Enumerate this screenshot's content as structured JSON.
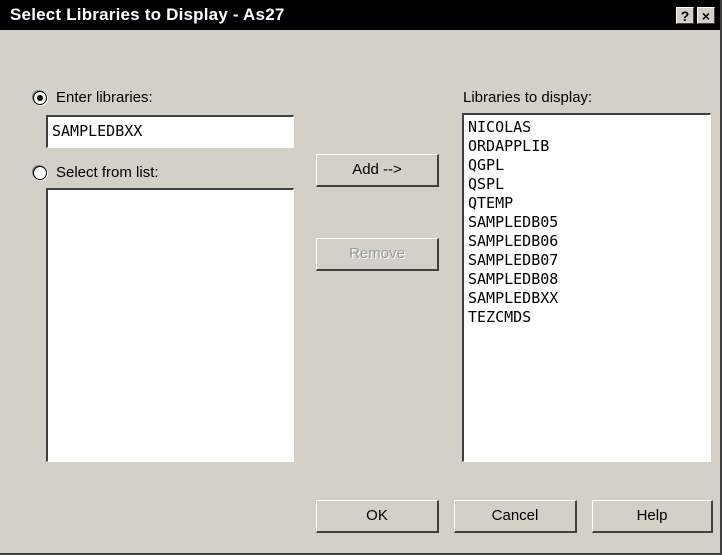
{
  "window": {
    "title": "Select Libraries to Display - As27",
    "help_button": "?",
    "close_button": "×"
  },
  "enter_libraries": {
    "label": "Enter libraries:",
    "value": "SAMPLEDBXX",
    "selected": true
  },
  "select_from_list": {
    "label": "Select from list:",
    "selected": false,
    "items": []
  },
  "libraries_to_display": {
    "label": "Libraries to display:",
    "items": [
      "NICOLAS",
      "ORDAPPLIB",
      "QGPL",
      "QSPL",
      "QTEMP",
      "SAMPLEDB05",
      "SAMPLEDB06",
      "SAMPLEDB07",
      "SAMPLEDB08",
      "SAMPLEDBXX",
      "TEZCMDS"
    ]
  },
  "buttons": {
    "add": "Add -->",
    "remove": "Remove",
    "ok": "OK",
    "cancel": "Cancel",
    "help": "Help"
  }
}
